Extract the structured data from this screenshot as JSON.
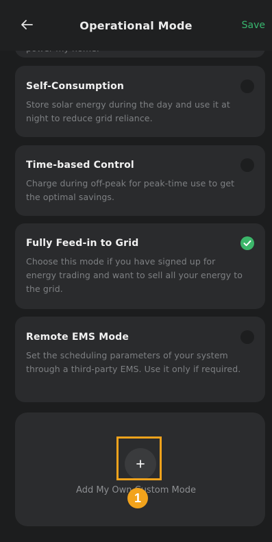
{
  "header": {
    "title": "Operational Mode",
    "save_label": "Save"
  },
  "modes": [
    {
      "id": "partial",
      "desc": "power my home."
    },
    {
      "id": "self-consumption",
      "title": "Self-Consumption",
      "desc": "Store solar energy during the day and use it at night to reduce grid reliance.",
      "selected": false
    },
    {
      "id": "time-based",
      "title": "Time-based Control",
      "desc": "Charge during off-peak for peak-time use to get the optimal savings.",
      "selected": false
    },
    {
      "id": "feed-in",
      "title": "Fully Feed-in to Grid",
      "desc": "Choose this mode if you have signed up for energy trading and want to sell all your energy to the grid.",
      "selected": true
    },
    {
      "id": "remote-ems",
      "title": "Remote EMS Mode",
      "desc": "Set the scheduling parameters of your system through a third-party EMS. Use it only if required.",
      "selected": false
    }
  ],
  "custom": {
    "label": "Add My Own Custom Mode",
    "badge": "1"
  },
  "colors": {
    "accent": "#3cb66a",
    "highlight": "#f2a31c"
  },
  "icons": {
    "back": "arrow-left-icon",
    "check": "check-icon",
    "add": "plus-icon"
  }
}
